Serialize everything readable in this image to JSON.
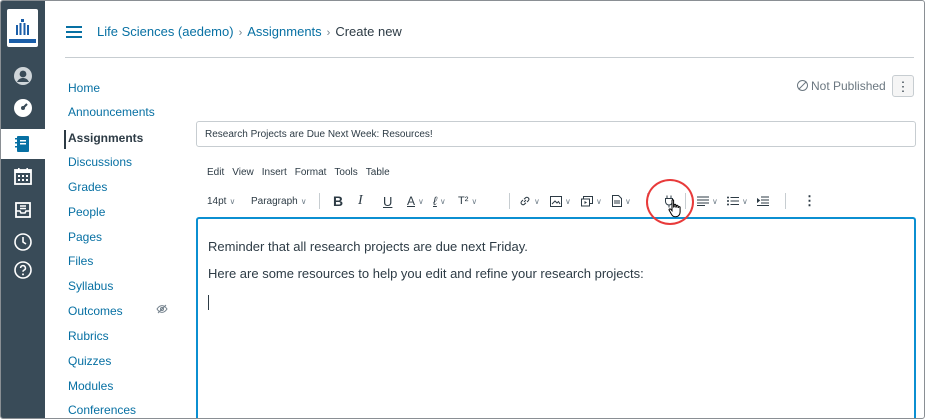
{
  "breadcrumb": {
    "course": "Life Sciences (aedemo)",
    "section": "Assignments",
    "current": "Create new",
    "separator": "›"
  },
  "course_nav": [
    {
      "label": "Home"
    },
    {
      "label": "Announcements"
    },
    {
      "label": "Assignments",
      "active": true
    },
    {
      "label": "Discussions"
    },
    {
      "label": "Grades"
    },
    {
      "label": "People"
    },
    {
      "label": "Pages"
    },
    {
      "label": "Files"
    },
    {
      "label": "Syllabus"
    },
    {
      "label": "Outcomes"
    },
    {
      "label": "Rubrics"
    },
    {
      "label": "Quizzes"
    },
    {
      "label": "Modules"
    },
    {
      "label": "Conferences"
    }
  ],
  "global_nav_icons": [
    "account-icon",
    "dashboard-icon",
    "courses-icon",
    "calendar-icon",
    "inbox-icon",
    "history-icon",
    "help-icon"
  ],
  "status": {
    "label": "Not Published"
  },
  "kebab_label": "⋮",
  "assignment": {
    "title": "Research Projects are Due Next Week: Resources!"
  },
  "editor": {
    "menu": [
      "Edit",
      "View",
      "Insert",
      "Format",
      "Tools",
      "Table"
    ],
    "font_size": "14pt",
    "block_format": "Paragraph",
    "body": [
      "Reminder that all research projects are due next Friday.",
      "Here are some resources to help you edit and refine your research projects:"
    ]
  },
  "colors": {
    "link": "#0770a3",
    "global_nav_bg": "#394b58",
    "editor_focus": "#0b8fd1",
    "highlight_circle": "#e83a3a"
  }
}
